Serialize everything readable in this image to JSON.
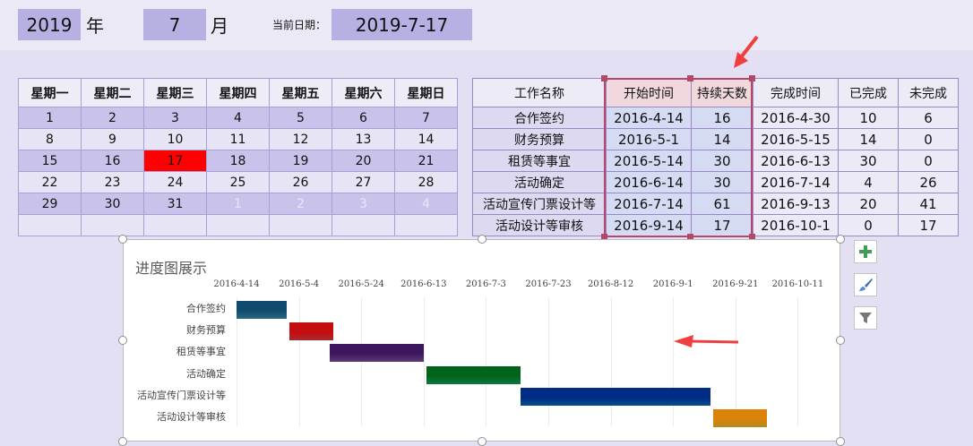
{
  "header": {
    "year": "2019",
    "year_unit": "年",
    "month": "7",
    "month_unit": "月",
    "date_label": "当前日期：",
    "current_date": "2019-7-17"
  },
  "calendar": {
    "weekdays": [
      "星期一",
      "星期二",
      "星期三",
      "星期四",
      "星期五",
      "星期六",
      "星期日"
    ],
    "rows": [
      [
        "1",
        "2",
        "3",
        "4",
        "5",
        "6",
        "7"
      ],
      [
        "8",
        "9",
        "10",
        "11",
        "12",
        "13",
        "14"
      ],
      [
        "15",
        "16",
        "17",
        "18",
        "19",
        "20",
        "21"
      ],
      [
        "22",
        "23",
        "24",
        "25",
        "26",
        "27",
        "28"
      ],
      [
        "29",
        "30",
        "31",
        "1",
        "2",
        "3",
        "4"
      ],
      [
        "",
        "",
        "",
        "",
        "",
        "",
        ""
      ]
    ],
    "today": "17"
  },
  "tasks": {
    "headers": [
      "工作名称",
      "开始时间",
      "持续天数",
      "完成时间",
      "已完成",
      "未完成"
    ],
    "rows": [
      [
        "合作签约",
        "2016-4-14",
        "16",
        "2016-4-30",
        "10",
        "6"
      ],
      [
        "财务预算",
        "2016-5-1",
        "14",
        "2016-5-15",
        "14",
        "0"
      ],
      [
        "租赁等事宜",
        "2016-5-14",
        "30",
        "2016-6-13",
        "30",
        "0"
      ],
      [
        "活动确定",
        "2016-6-14",
        "30",
        "2016-7-14",
        "4",
        "26"
      ],
      [
        "活动宣传门票设计等",
        "2016-7-14",
        "61",
        "2016-9-13",
        "20",
        "41"
      ],
      [
        "活动设计等审核",
        "2016-9-14",
        "17",
        "2016-10-1",
        "0",
        "17"
      ]
    ]
  },
  "chart_data": {
    "type": "bar",
    "orientation": "horizontal-gantt",
    "title": "进度图展示",
    "x_axis_position": "top",
    "x_ticks": [
      "2016-4-14",
      "2016-5-4",
      "2016-5-24",
      "2016-6-13",
      "2016-7-3",
      "2016-7-23",
      "2016-8-12",
      "2016-9-1",
      "2016-9-21",
      "2016-10-11"
    ],
    "x_range": [
      "2016-4-14",
      "2016-10-31"
    ],
    "categories": [
      "合作签约",
      "财务预算",
      "租赁等事宜",
      "活动确定",
      "活动宣传门票设计等",
      "活动设计等审核"
    ],
    "starts": [
      "2016-4-14",
      "2016-5-1",
      "2016-5-14",
      "2016-6-14",
      "2016-7-14",
      "2016-9-14"
    ],
    "durations": [
      16,
      14,
      30,
      30,
      61,
      17
    ],
    "colors": [
      "#3f8aa8",
      "#e0383e",
      "#7d4d9a",
      "#12a052",
      "#0a6ab8",
      "#ecb72c"
    ],
    "grid": true,
    "legend": "none"
  },
  "side_buttons": {
    "add_icon": "plus-icon",
    "style_icon": "brush-icon",
    "filter_icon": "filter-icon"
  },
  "annotations": {
    "arrow_color": "#f13d3d"
  }
}
